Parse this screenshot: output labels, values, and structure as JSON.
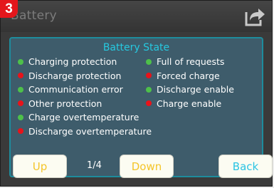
{
  "header": {
    "title": "Battery",
    "badge": "3"
  },
  "panel": {
    "title": "Battery State",
    "left_items": [
      {
        "label": "Charging protection",
        "status": "green"
      },
      {
        "label": "Discharge protection",
        "status": "red"
      },
      {
        "label": "Communication error",
        "status": "green"
      },
      {
        "label": "Other protection",
        "status": "red"
      },
      {
        "label": "Charge overtemperature",
        "status": "green"
      },
      {
        "label": "Discharge overtemperature",
        "status": "red"
      }
    ],
    "right_items": [
      {
        "label": "Full of requests",
        "status": "green"
      },
      {
        "label": "Forced charge",
        "status": "red"
      },
      {
        "label": "Discharge enable",
        "status": "green"
      },
      {
        "label": "Charge enable",
        "status": "red"
      }
    ]
  },
  "footer": {
    "up_label": "Up",
    "page_indicator": "1/4",
    "down_label": "Down",
    "back_label": "Back"
  },
  "colors": {
    "green": "#4ec04a",
    "red": "#e8131a",
    "accent": "#26c9e0"
  },
  "icons": {
    "share": "share-icon"
  }
}
